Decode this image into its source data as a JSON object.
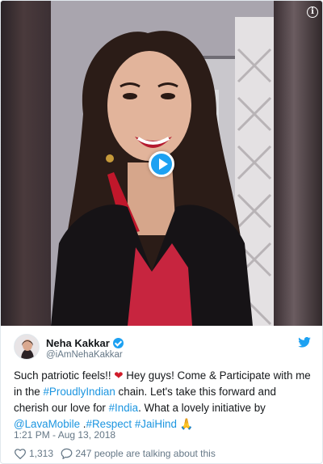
{
  "media": {
    "info_icon": "info-icon",
    "play_icon": "play-icon",
    "info_glyph": "i"
  },
  "author": {
    "name": "Neha Kakkar",
    "handle": "@iAmNehaKakkar",
    "verified_icon": "verified-badge-icon",
    "platform_icon": "twitter-bird-icon"
  },
  "tweet": {
    "part1": "Such patriotic feels!! ",
    "heart": "❤",
    "part2": " Hey guys! Come & Participate with me in the ",
    "hashtag1": "#ProudlyIndian",
    "part3": " chain. Let's take this forward and cherish our love for ",
    "hashtag2": "#India",
    "part4": ". What a lovely initiative by ",
    "mention": "@LavaMobile",
    "part5": " .",
    "hashtag3": "#Respect",
    "hashtag4": "#JaiHind",
    "emoji": "🙏"
  },
  "timestamp": "1:21 PM - Aug 13, 2018",
  "engagement": {
    "likes": "1,313",
    "talking": "247 people are talking about this",
    "like_icon": "heart-icon",
    "reply_icon": "speech-bubble-icon"
  },
  "colors": {
    "link": "#1b95e0",
    "twitter_blue": "#1da1f2",
    "muted": "#657786"
  }
}
